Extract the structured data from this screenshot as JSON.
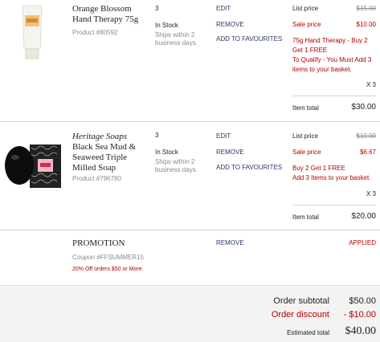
{
  "items": [
    {
      "name": "Orange Blossom Hand Therapy 75g",
      "brand": "",
      "product_no": "Product #80592",
      "quantity": "3",
      "stock": "In Stock",
      "shipping": "Ships within 2 business days.",
      "actions": {
        "edit": "EDIT",
        "remove": "REMOVE",
        "favourite": "ADD TO FAVOURITES"
      },
      "list_price_label": "List price",
      "list_price": "$15.00",
      "sale_price_label": "Sale price",
      "sale_price": "$10.00",
      "promo_line1": "75g Hand Therapy - Buy 2 Get 1 FREE",
      "promo_line2": "To Qualify - You Must Add 3 items to your basket.",
      "qty_mult": "X 3",
      "item_total_label": "Item total",
      "item_total": "$30.00"
    },
    {
      "name": "Black Sea Mud & Seaweed Triple Milled Soap",
      "brand": "Heritage Soaps",
      "product_no": "Product #796780",
      "quantity": "3",
      "stock": "In Stock",
      "shipping": "Ships within 2 business days.",
      "actions": {
        "edit": "EDIT",
        "remove": "REMOVE",
        "favourite": "ADD TO FAVOURITES"
      },
      "list_price_label": "List price",
      "list_price": "$10.00",
      "sale_price_label": "Sale price",
      "sale_price": "$6.67",
      "promo_line1": "Buy 2 Get 1 FREE",
      "promo_line2": "Add 3 Items to your basket.",
      "qty_mult": "X 3",
      "item_total_label": "Item total",
      "item_total": "$20.00"
    }
  ],
  "promotion": {
    "title": "PROMOTION",
    "coupon": "Coupon #FFSUMMER15",
    "description": "20% Off orders $50 or More.",
    "remove": "REMOVE",
    "status": "APPLIED"
  },
  "summary": {
    "subtotal_label": "Order subtotal",
    "subtotal": "$50.00",
    "discount_label": "Order discount",
    "discount": "- $10.00",
    "estimated_label": "Estimated total",
    "estimated": "$40.00"
  },
  "colors": {
    "accent_red": "#b30000",
    "link_navy": "#2b3a67",
    "muted": "#8a8a8a",
    "summary_bg": "#f4f3f1"
  }
}
